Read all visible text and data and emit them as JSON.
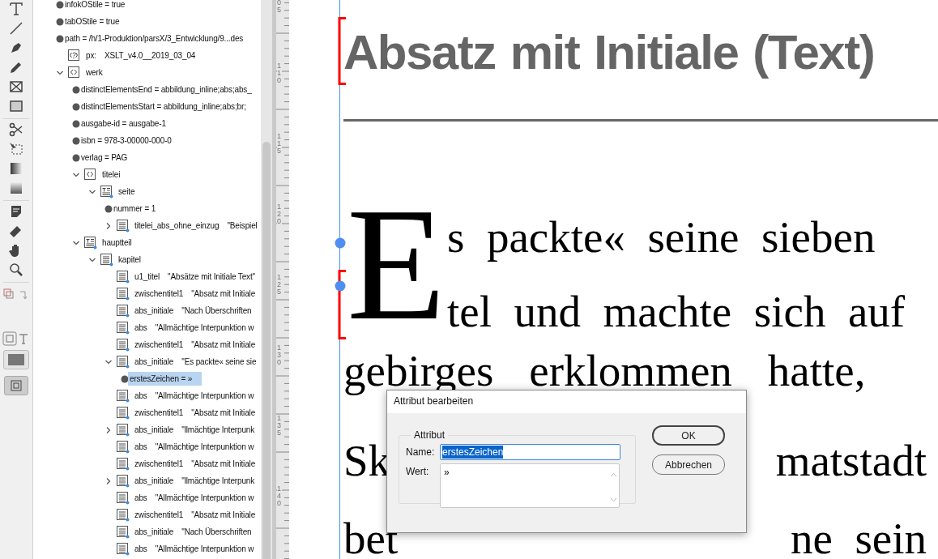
{
  "structure_panel": {
    "items": [
      {
        "kind": "attribute",
        "text": "infokOStile = true",
        "selected": false
      },
      {
        "kind": "attribute",
        "text": "tabOStile = true",
        "selected": false
      },
      {
        "kind": "attribute",
        "text": "path = /h/1-Produktion/parsX/3_Entwicklung/9...des",
        "selected": false
      },
      {
        "kind": "instruction",
        "name": "px:",
        "value": "XSLT_v4.0__2019_03_04",
        "selected": false
      },
      {
        "kind": "element",
        "name": "werk",
        "expanded": true,
        "selected": false,
        "children": [
          {
            "kind": "attribute",
            "text": "distinctElementsEnd = abbildung_inline;abs;abs_",
            "selected": false
          },
          {
            "kind": "attribute",
            "text": "distinctElementsStart = abbildung_inline;abs;br;",
            "selected": false
          },
          {
            "kind": "attribute",
            "text": "ausgabe-id = ausgabe-1",
            "selected": false
          },
          {
            "kind": "attribute",
            "text": "isbn = 978-3-00000-000-0",
            "selected": false
          },
          {
            "kind": "attribute",
            "text": "verlag = PAG",
            "selected": false
          },
          {
            "kind": "element",
            "name": "titelei",
            "expanded": true,
            "selected": false,
            "children": [
              {
                "kind": "section",
                "name": "seite",
                "expanded": true,
                "selected": false,
                "children": [
                  {
                    "kind": "attribute",
                    "text": "nummer = 1",
                    "selected": false
                  },
                  {
                    "kind": "paragraph",
                    "name": "titelei_abs_ohne_einzug",
                    "value": "\"Beispiel",
                    "expanded": false,
                    "selected": false
                  }
                ]
              }
            ]
          },
          {
            "kind": "section",
            "name": "hauptteil",
            "expanded": true,
            "selected": false,
            "children": [
              {
                "kind": "paragraph",
                "name": "kapitel",
                "expanded": true,
                "selected": false,
                "children": [
                  {
                    "kind": "paragraph",
                    "name": "u1_titel",
                    "value": "\"Absätze mit Initiale Text\"",
                    "selected": false
                  },
                  {
                    "kind": "paragraph",
                    "name": "zwischentitel1",
                    "value": "\"Absatz mit Initiale",
                    "selected": false
                  },
                  {
                    "kind": "paragraph",
                    "name": "abs_initiale",
                    "value": "\"Nach Überschriften",
                    "selected": false
                  },
                  {
                    "kind": "paragraph",
                    "name": "abs",
                    "value": "\"Allmächtige Interpunktion w",
                    "selected": false
                  },
                  {
                    "kind": "paragraph",
                    "name": "zwischentitel1",
                    "value": "\"Absatz mit Initiale",
                    "selected": false
                  },
                  {
                    "kind": "paragraph",
                    "name": "abs_initiale",
                    "value": "\"Es packte« seine sie",
                    "expanded": true,
                    "selected": false,
                    "children": [
                      {
                        "kind": "attribute",
                        "text": "erstesZeichen = »",
                        "selected": true
                      }
                    ]
                  },
                  {
                    "kind": "paragraph",
                    "name": "abs",
                    "value": "\"Allmächtige Interpunktion w",
                    "selected": false
                  },
                  {
                    "kind": "paragraph",
                    "name": "zwischentitel1",
                    "value": "\"Absatz mit Initiale",
                    "selected": false
                  },
                  {
                    "kind": "paragraph",
                    "name": "abs_initiale",
                    "value": "\"llmächtige Interpunk",
                    "expanded": false,
                    "selected": false
                  },
                  {
                    "kind": "paragraph",
                    "name": "abs",
                    "value": "\"Allmächtige Interpunktion w",
                    "selected": false
                  },
                  {
                    "kind": "paragraph",
                    "name": "zwischentitel1",
                    "value": "\"Absatz mit Initiale",
                    "selected": false
                  },
                  {
                    "kind": "paragraph",
                    "name": "abs_initiale",
                    "value": "\"llmächtige Interpunk",
                    "expanded": false,
                    "selected": false
                  },
                  {
                    "kind": "paragraph",
                    "name": "abs",
                    "value": "\"Allmächtige Interpunktion w",
                    "selected": false
                  },
                  {
                    "kind": "paragraph",
                    "name": "zwischentitel1",
                    "value": "\"Absatz mit Initiale",
                    "selected": false
                  },
                  {
                    "kind": "paragraph",
                    "name": "abs_initiale",
                    "value": "\"Nach Überschriften",
                    "selected": false
                  },
                  {
                    "kind": "paragraph",
                    "name": "abs",
                    "value": "\"Allmächtige Interpunktion w",
                    "selected": false
                  }
                ]
              }
            ]
          }
        ]
      }
    ]
  },
  "ruler": {
    "labels": [
      "05",
      "110",
      "115",
      "120",
      "125",
      "130",
      "135",
      "140"
    ]
  },
  "document": {
    "heading": "Absatz mit Initiale (Text)",
    "drop_cap": "E",
    "lines": [
      [
        "s packte« seine sieben"
      ],
      [
        "tel und machte sich auf"
      ],
      [
        "gebirges erklommen hatte,"
      ],
      [
        "Sk",
        "matstadt"
      ],
      [
        "bet",
        "ne sein"
      ]
    ]
  },
  "dialog": {
    "title": "Attribut bearbeiten",
    "group": "Attribut",
    "name_label": "Name:",
    "name_value": "erstesZeichen",
    "value_label": "Wert:",
    "value": "»",
    "buttons": [
      {
        "label": "OK",
        "default": true
      },
      {
        "label": "Abbrechen",
        "default": false
      }
    ]
  }
}
